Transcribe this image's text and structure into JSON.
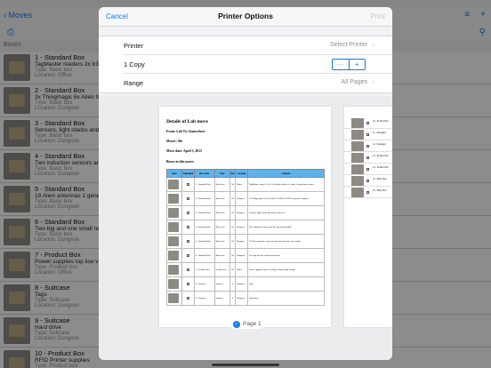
{
  "app": {
    "back_label": "Moves",
    "section_header": "Boxes",
    "boxes": [
      {
        "title": "1 - Standard Box",
        "desc": "TagMaster readers 2x lr3 1x",
        "type": "Type: Basic box",
        "location": "Location: Office"
      },
      {
        "title": "2 - Standard Box",
        "desc": "3x Thingmagic 6x Alien 96",
        "type": "Type: Basic box",
        "location": "Location: Dungeon"
      },
      {
        "title": "3 - Standard Box",
        "desc": "Sensors, light stacks and r",
        "type": "Type: Basic box",
        "location": "Location: Dungeon"
      },
      {
        "title": "4 - Standard Box",
        "desc": "Two induction sensors and",
        "type": "Type: Basic box",
        "location": "Location: Dungeon"
      },
      {
        "title": "5 - Standard Box",
        "desc": "18 Alien antennas 1 generic",
        "type": "Type: Basic box",
        "location": "Location: Dungeon"
      },
      {
        "title": "6 - Standard Box",
        "desc": "Two big and one small nem",
        "type": "Type: Basic box",
        "location": "Location: Dungeon"
      },
      {
        "title": "7 - Product Box",
        "desc": "Power supplies top low volt",
        "type": "Type: Product box",
        "location": "Location: Office"
      },
      {
        "title": "8 - Suitcase",
        "desc": "Tags",
        "type": "Type: Suitcase",
        "location": "Location: Dungeon"
      },
      {
        "title": "9 - Suitcase",
        "desc": "Hard drive",
        "type": "Type: Suitcase",
        "location": "Location: Dungeon"
      },
      {
        "title": "10 - Product Box",
        "desc": "RFID Printer supplies",
        "type": "Type: Product box",
        "location": ""
      }
    ]
  },
  "modal": {
    "cancel_label": "Cancel",
    "title": "Printer Options",
    "print_label": "Print",
    "printer_label": "Printer",
    "printer_value": "Select Printer",
    "copies_label": "1 Copy",
    "stepper_minus": "—",
    "stepper_plus": "+",
    "range_label": "Range",
    "range_value": "All Pages",
    "page_label": "Page 1"
  },
  "document": {
    "title": "Details of Lab move",
    "from": "From: Lab To: Somewhere",
    "mover": "Mover: Me",
    "date": "Move date: April 3, 2015",
    "boxes_heading": "Boxes in this move:",
    "columns": [
      "Item",
      "Unpacked",
      "Box name",
      "Type",
      "Size",
      "Location",
      "Contents"
    ],
    "rows": [
      {
        "name": "1 - Standard Box",
        "type": "Basic box",
        "size": "M",
        "location": "Office",
        "contents": "TagMaster readers 2x lr3 1x lr4 plus cables 2x cards 2x proximity sensor"
      },
      {
        "name": "2 - Standard Box",
        "type": "Basic box",
        "size": "M",
        "location": "Dungeon",
        "contents": "3x Thingmagic 6x Alien 9650 2x 9900 2x 9800 and power supplies"
      },
      {
        "name": "3 - Standard Box",
        "type": "Basic box",
        "size": "M",
        "location": "Dungeon",
        "contents": "Sensors, light stacks and relay cables etc"
      },
      {
        "name": "4 - Standard Box",
        "type": "Basic box",
        "size": "M",
        "location": "Dungeon",
        "contents": "Two induction sensors and the big antenna table"
      },
      {
        "name": "5 - Standard Box",
        "type": "Basic box",
        "size": "M",
        "location": "Dungeon",
        "contents": "18 Alien antennas 1 generic antenna and some coax cables"
      },
      {
        "name": "6 - Standard Box",
        "type": "Basic box",
        "size": "M",
        "location": "Dungeon",
        "contents": "Two big and one small nema boxes"
      },
      {
        "name": "7 - Product Box",
        "type": "Product box",
        "size": "M",
        "location": "Office",
        "contents": "Power supplies top low voltage bottom high voltage"
      },
      {
        "name": "8 - Suitcase",
        "type": "Suitcase",
        "size": "S",
        "location": "Dungeon",
        "contents": "Tags"
      },
      {
        "name": "9 - Suitcase",
        "type": "Suitcase",
        "size": "S",
        "location": "Dungeon",
        "contents": "Hard drive"
      }
    ],
    "side_rows": [
      "10 - Product Box",
      "11 - Packaged",
      "12 - Packaged",
      "13 - Product Box",
      "14 - Product Box",
      "15 - Basic Box",
      "16 - Basic Box"
    ]
  },
  "colors": {
    "accent": "#1478f5",
    "table_header": "#5fb3ea"
  }
}
